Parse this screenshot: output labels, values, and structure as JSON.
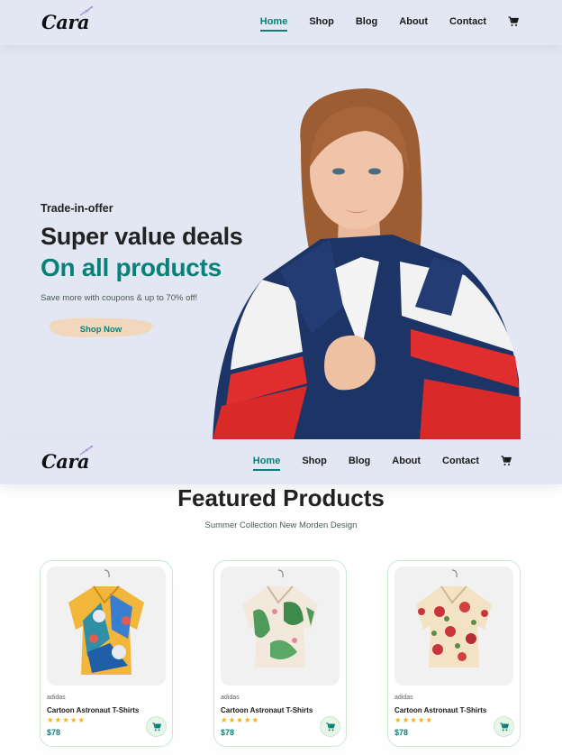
{
  "brand": {
    "logo_text": "Cara"
  },
  "nav": {
    "items": [
      {
        "label": "Home",
        "active": true
      },
      {
        "label": "Shop",
        "active": false
      },
      {
        "label": "Blog",
        "active": false
      },
      {
        "label": "About",
        "active": false
      },
      {
        "label": "Contact",
        "active": false
      }
    ],
    "cart_icon": "shopping-cart-icon"
  },
  "hero": {
    "kicker": "Trade-in-offer",
    "headline": "Super value deals",
    "headline_accent": "On all products",
    "subtext": "Save more with coupons & up to 70% off!",
    "cta_label": "Shop Now"
  },
  "featured": {
    "title": "Featured Products",
    "subtitle": "Summer Collection New Morden Design",
    "products": [
      {
        "brand": "adidas",
        "name": "Cartoon Astronaut T-Shirts",
        "rating": 5,
        "stars": "★★★★★",
        "price": "$78"
      },
      {
        "brand": "adidas",
        "name": "Cartoon Astronaut T-Shirts",
        "rating": 5,
        "stars": "★★★★★",
        "price": "$78"
      },
      {
        "brand": "adidas",
        "name": "Cartoon Astronaut T-Shirts",
        "rating": 5,
        "stars": "★★★★★",
        "price": "$78"
      }
    ]
  },
  "colors": {
    "accent": "#088178",
    "nav_bg": "#e3e6f3",
    "star": "#f3b519",
    "cta_brush": "#f1d8bd"
  }
}
